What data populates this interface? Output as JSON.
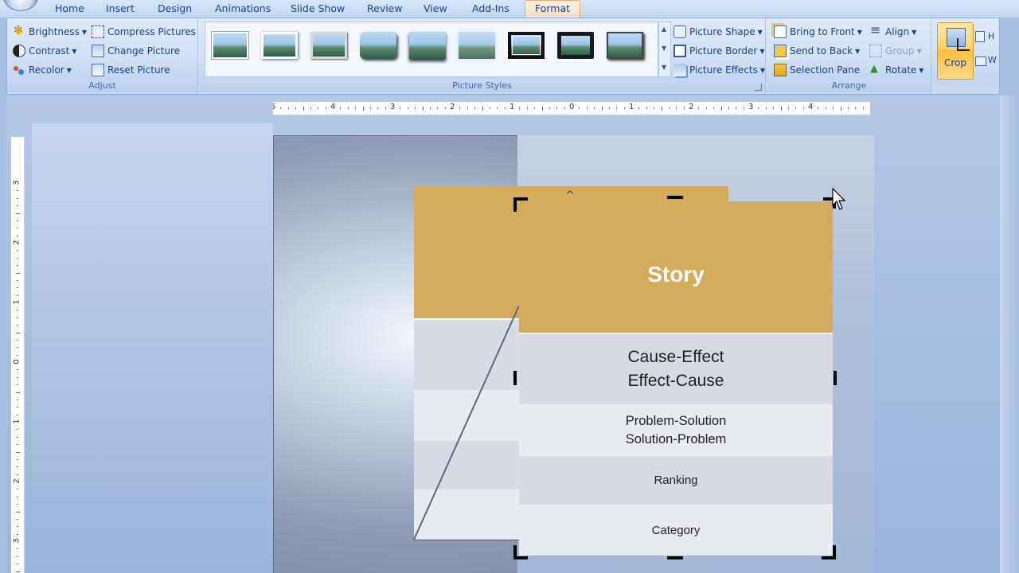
{
  "tabs": [
    "Home",
    "Insert",
    "Design",
    "Animations",
    "Slide Show",
    "Review",
    "View",
    "Add-Ins",
    "Format"
  ],
  "active_tab": "Format",
  "ribbon": {
    "adjust": {
      "label": "Adjust",
      "brightness": "Brightness",
      "contrast": "Contrast",
      "recolor": "Recolor",
      "compress": "Compress Pictures",
      "change": "Change Picture",
      "reset": "Reset Picture"
    },
    "picture_styles": {
      "label": "Picture Styles",
      "picture_shape": "Picture Shape",
      "picture_border": "Picture Border",
      "picture_effects": "Picture Effects"
    },
    "arrange": {
      "label": "Arrange",
      "bring_to_front": "Bring to Front",
      "send_to_back": "Send to Back",
      "selection_pane": "Selection Pane",
      "align": "Align",
      "group": "Group",
      "rotate": "Rotate"
    },
    "size": {
      "crop": "Crop",
      "height_partial": "H",
      "width_partial": "W"
    }
  },
  "ruler_h": [
    "5",
    "4",
    "3",
    "2",
    "1",
    "0",
    "1",
    "2",
    "3",
    "4"
  ],
  "ruler_v": [
    "3",
    "2",
    "1",
    "0",
    "1",
    "2",
    "3"
  ],
  "slide_table": {
    "header": "Story",
    "rows": [
      [
        "Cause-Effect",
        "Effect-Cause"
      ],
      [
        "Problem-Solution",
        "Solution-Problem"
      ],
      [
        "Ranking"
      ],
      [
        "Category"
      ]
    ]
  },
  "colors": {
    "header_gold": "#d4ab5d",
    "row_dark": "#d6dbe3",
    "row_light": "#e8ebf0",
    "ribbon_text": "#15428b",
    "active_tab_border": "#e3a77e"
  }
}
